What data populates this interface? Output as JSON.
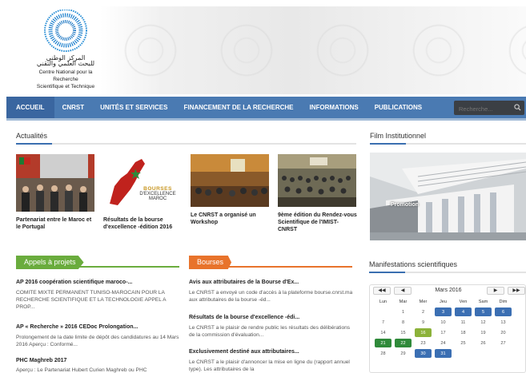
{
  "logo": {
    "arabic_line1": "المركز الوطني",
    "arabic_line2": "للبحث العلمي والتقني",
    "french_line1": "Centre National pour la Recherche",
    "french_line2": "Scientifique et Technique"
  },
  "nav": {
    "items": [
      "ACCUEIL",
      "CNRST",
      "UNITÉS ET SERVICES",
      "FINANCEMENT DE LA RECHERCHE",
      "INFORMATIONS",
      "PUBLICATIONS"
    ],
    "search_placeholder": "Recherche..."
  },
  "actualites": {
    "title": "Actualités",
    "items": [
      {
        "caption": "Partenariat entre le Maroc et le Portugal"
      },
      {
        "caption": "Résultats de la bourse d'excellence -édition 2016",
        "thumb_line1": "BOURSES",
        "thumb_line2": "D'EXCELLENCE",
        "thumb_line3": "MAROC"
      },
      {
        "caption": "Le CNRST a organisé un Workshop"
      },
      {
        "caption": "9ème édition du Rendez-vous Scientifique de l'IMIST-CNRST"
      }
    ]
  },
  "film": {
    "title": "Film Institutionnel",
    "overlay": "Promotion"
  },
  "appels": {
    "tab": "Appels à projets",
    "items": [
      {
        "title": "AP 2016 coopération scientifique maroco-...",
        "desc": "COMITE MIXTE PERMANENT TUNISO-MAROCAIN POUR LA RECHERCHE SCIENTIFIQUE ET LA TECHNOLOGIE APPEL A PROP..."
      },
      {
        "title": "AP « Recherche » 2016 CEDoc Prolongation...",
        "desc": "Prolongement de la date limite de dépôt des candidatures au 14 Mars 2016 Aperçu : Conformé..."
      },
      {
        "title": "PHC Maghreb 2017",
        "desc": "Aperçu : Le Partenariat Hubert Curien Maghreb ou PHC"
      }
    ]
  },
  "bourses": {
    "tab": "Bourses",
    "items": [
      {
        "title": "Avis aux attributaires de la Bourse d'Ex...",
        "desc": "Le CNRST a envoyé un code d'accès à la plateforme bourse.cnrst.ma aux attributaires de la bourse -éd..."
      },
      {
        "title": "Résultats de la bourse d'excellence -édi...",
        "desc": "Le CNRST a le plaisir de rendre public les résultats des délibérations de la commission d'évaluation..."
      },
      {
        "title": "Exclusivement destiné aux attributaires...",
        "desc": "Le CNRST a le plaisir d'annoncer la mise en ligne du (rapport annuel type). Les attributaires de la"
      }
    ]
  },
  "manifestations": {
    "title": "Manifestations scientifiques",
    "calendar": {
      "month": "Mars 2016",
      "prev_year": "◀◀",
      "prev": "◀",
      "next": "▶",
      "next_year": "▶▶",
      "weekdays": [
        "Lun",
        "Mar",
        "Mer",
        "Jeu",
        "Ven",
        "Sam",
        "Dim"
      ],
      "weeks": [
        [
          {
            "d": ""
          },
          {
            "d": "1"
          },
          {
            "d": "2"
          },
          {
            "d": "3",
            "s": "blue"
          },
          {
            "d": "4",
            "s": "blue"
          },
          {
            "d": "5",
            "s": "blue"
          },
          {
            "d": "6",
            "s": "blue"
          }
        ],
        [
          {
            "d": "7"
          },
          {
            "d": "8"
          },
          {
            "d": "9"
          },
          {
            "d": "10"
          },
          {
            "d": "11"
          },
          {
            "d": "12"
          },
          {
            "d": "13"
          }
        ],
        [
          {
            "d": "14"
          },
          {
            "d": "15"
          },
          {
            "d": "16",
            "s": "olive"
          },
          {
            "d": "17"
          },
          {
            "d": "18"
          },
          {
            "d": "19"
          },
          {
            "d": "20"
          }
        ],
        [
          {
            "d": "21",
            "s": "green"
          },
          {
            "d": "22",
            "s": "green"
          },
          {
            "d": "23"
          },
          {
            "d": "24"
          },
          {
            "d": "25"
          },
          {
            "d": "26"
          },
          {
            "d": "27"
          }
        ],
        [
          {
            "d": "28"
          },
          {
            "d": "29"
          },
          {
            "d": "30",
            "s": "blue"
          },
          {
            "d": "31",
            "s": "blue"
          },
          {
            "d": ""
          },
          {
            "d": ""
          },
          {
            "d": ""
          }
        ]
      ]
    }
  },
  "colors": {
    "nav_bg": "#4a7ab2",
    "appels_green": "#6aac3d",
    "bourses_orange": "#e8732b",
    "accent_blue": "#3a6fb0"
  }
}
